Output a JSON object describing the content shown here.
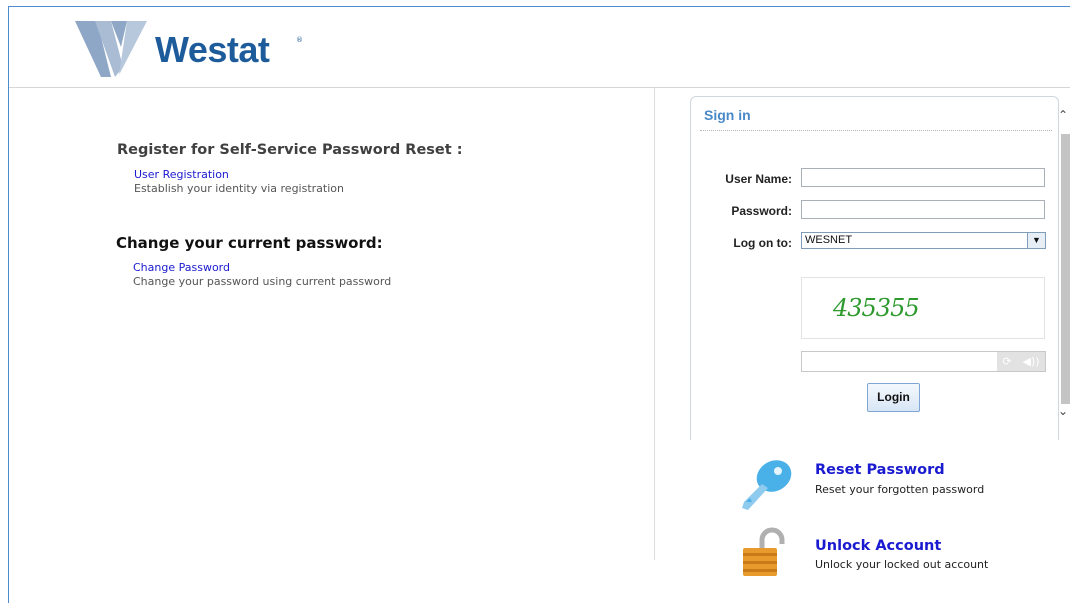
{
  "header": {
    "logo_text": "Westat",
    "logo_mark": "®"
  },
  "left": {
    "register_heading": "Register for Self-Service Password Reset :",
    "user_registration_link": "User Registration",
    "user_registration_desc": "Establish your identity via registration",
    "change_heading": "Change your current password:",
    "change_password_link": "Change Password",
    "change_password_desc": "Change your password using current password"
  },
  "signin": {
    "title": "Sign in",
    "username_label": "User Name:",
    "password_label": "Password:",
    "logon_label": "Log on to:",
    "logon_value": "WESNET",
    "captcha_text": "435355",
    "login_button": "Login"
  },
  "actions": {
    "reset_title": "Reset Password",
    "reset_desc": "Reset your forgotten password",
    "unlock_title": "Unlock Account",
    "unlock_desc": "Unlock your locked out account"
  },
  "colors": {
    "brand": "#1d5b9a",
    "link": "#1a1ad0",
    "signin_title": "#4a89c8",
    "captcha": "#2e9a2e"
  }
}
